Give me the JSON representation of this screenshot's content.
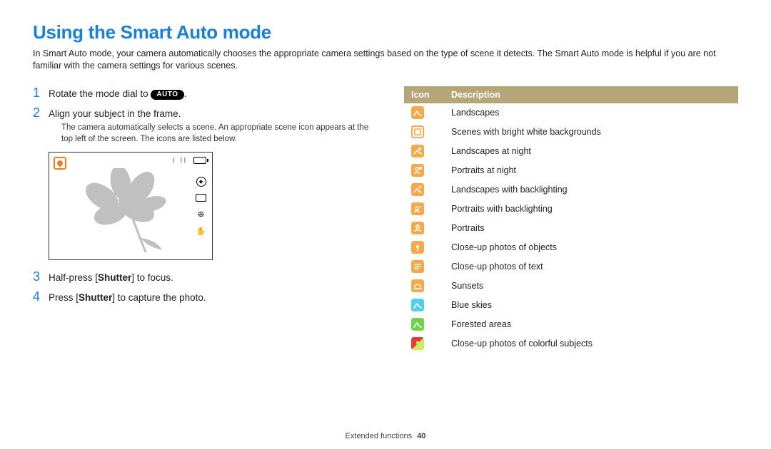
{
  "title": "Using the Smart Auto mode",
  "intro": "In Smart Auto mode, your camera automatically chooses the appropriate camera settings based on the type of scene it detects. The Smart Auto mode is helpful if you are not familiar with the camera settings for various scenes.",
  "steps": {
    "s1": {
      "num": "1",
      "pre": "Rotate the mode dial to ",
      "pill": "AUTO",
      "post": "."
    },
    "s2": {
      "num": "2",
      "text": "Align your subject in the frame.",
      "note": "The camera automatically selects a scene. An appropriate scene icon appears at the top left of the screen. The icons are listed below."
    },
    "s3": {
      "num": "3",
      "pre": "Half-press [",
      "bold": "Shutter",
      "post": "] to focus."
    },
    "s4": {
      "num": "4",
      "pre": "Press [",
      "bold": "Shutter",
      "post": "] to capture the photo."
    }
  },
  "table": {
    "headers": {
      "icon": "Icon",
      "desc": "Description"
    },
    "rows": [
      {
        "color": "#f7a84a",
        "glyph": "mountain",
        "stroke": "#fff",
        "desc": "Landscapes"
      },
      {
        "color": "#ffffff",
        "border": "#f7a84a",
        "glyph": "square",
        "stroke": "#f7a84a",
        "desc": "Scenes with bright white backgrounds"
      },
      {
        "color": "#f7a84a",
        "glyph": "mountain-moon",
        "stroke": "#fff",
        "desc": "Landscapes at night"
      },
      {
        "color": "#f7a84a",
        "glyph": "person-moon",
        "stroke": "#fff",
        "desc": "Portraits at night"
      },
      {
        "color": "#f7a84a",
        "glyph": "mountain-sun",
        "stroke": "#fff",
        "desc": "Landscapes with backlighting"
      },
      {
        "color": "#f7a84a",
        "glyph": "person-sun",
        "stroke": "#fff",
        "desc": "Portraits with backlighting"
      },
      {
        "color": "#f7a84a",
        "glyph": "person",
        "stroke": "#fff",
        "desc": "Portraits"
      },
      {
        "color": "#f7a84a",
        "glyph": "tulip",
        "stroke": "#fff",
        "desc": "Close-up photos of objects"
      },
      {
        "color": "#f7a84a",
        "glyph": "text",
        "stroke": "#fff",
        "desc": "Close-up photos of text"
      },
      {
        "color": "#f7a84a",
        "glyph": "sunset",
        "stroke": "#fff",
        "desc": "Sunsets"
      },
      {
        "color": "#4ed0e8",
        "glyph": "mountain",
        "stroke": "#fff",
        "desc": "Blue skies"
      },
      {
        "color": "#6fd44a",
        "glyph": "mountain",
        "stroke": "#fff",
        "desc": "Forested areas"
      },
      {
        "color": "#e83a3a",
        "glyph": "tulip",
        "stroke": "#c8f05a",
        "half": "#c8f05a",
        "desc": "Close-up photos of colorful subjects"
      }
    ]
  },
  "footer": {
    "section": "Extended functions",
    "page": "40"
  }
}
